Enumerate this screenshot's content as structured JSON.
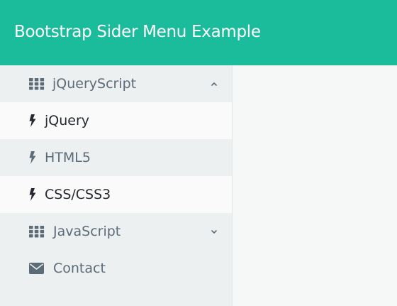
{
  "header": {
    "title": "Bootstrap Sider Menu Example"
  },
  "sidebar": {
    "items": [
      {
        "label": "jQueryScript",
        "icon": "grid-icon",
        "expanded": true,
        "caret": "chevron-up-icon"
      },
      {
        "label": "jQuery",
        "icon": "bolt-icon"
      },
      {
        "label": "HTML5",
        "icon": "bolt-icon"
      },
      {
        "label": "CSS/CSS3",
        "icon": "bolt-icon"
      },
      {
        "label": "JavaScript",
        "icon": "grid-icon",
        "expanded": false,
        "caret": "chevron-down-icon"
      },
      {
        "label": "Contact",
        "icon": "envelope-icon"
      }
    ]
  },
  "colors": {
    "brand": "#1abc9c",
    "sidebar_bg": "#ecf0f1",
    "active_bg": "#fafafa",
    "text_muted": "#5b6b78",
    "text_dark": "#24292f"
  }
}
